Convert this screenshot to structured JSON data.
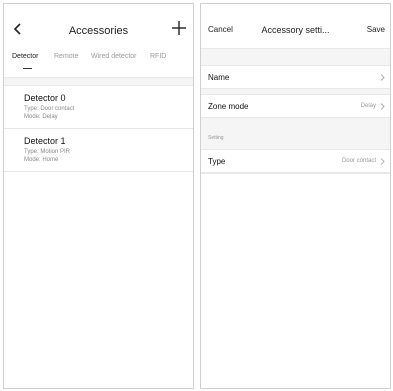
{
  "accessories": {
    "title": "Accessories",
    "tabs": [
      {
        "label": "Detector",
        "active": true
      },
      {
        "label": "Remote",
        "active": false
      },
      {
        "label": "Wired detector",
        "active": false
      },
      {
        "label": "RFID",
        "active": false
      }
    ],
    "detectors": [
      {
        "name": "Detector 0",
        "type": "Type: Door contact",
        "mode": "Mode: Delay"
      },
      {
        "name": "Detector 1",
        "type": "Type: Motion PIR",
        "mode": "Mode: Home"
      }
    ],
    "icons": {
      "back": "chevron-left-icon",
      "add": "plus-icon"
    }
  },
  "settings": {
    "cancel_label": "Cancel",
    "title": "Accessory setti...",
    "save_label": "Save",
    "name_label": "Name",
    "zone_mode_label": "Zone mode",
    "zone_mode_value": "Delay",
    "section_label": "Setting",
    "type_label": "Type",
    "type_value": "Door contact"
  },
  "colors": {
    "divider": "#e6e6e6",
    "background": "#f5f5f5",
    "muted_text": "#999999"
  }
}
